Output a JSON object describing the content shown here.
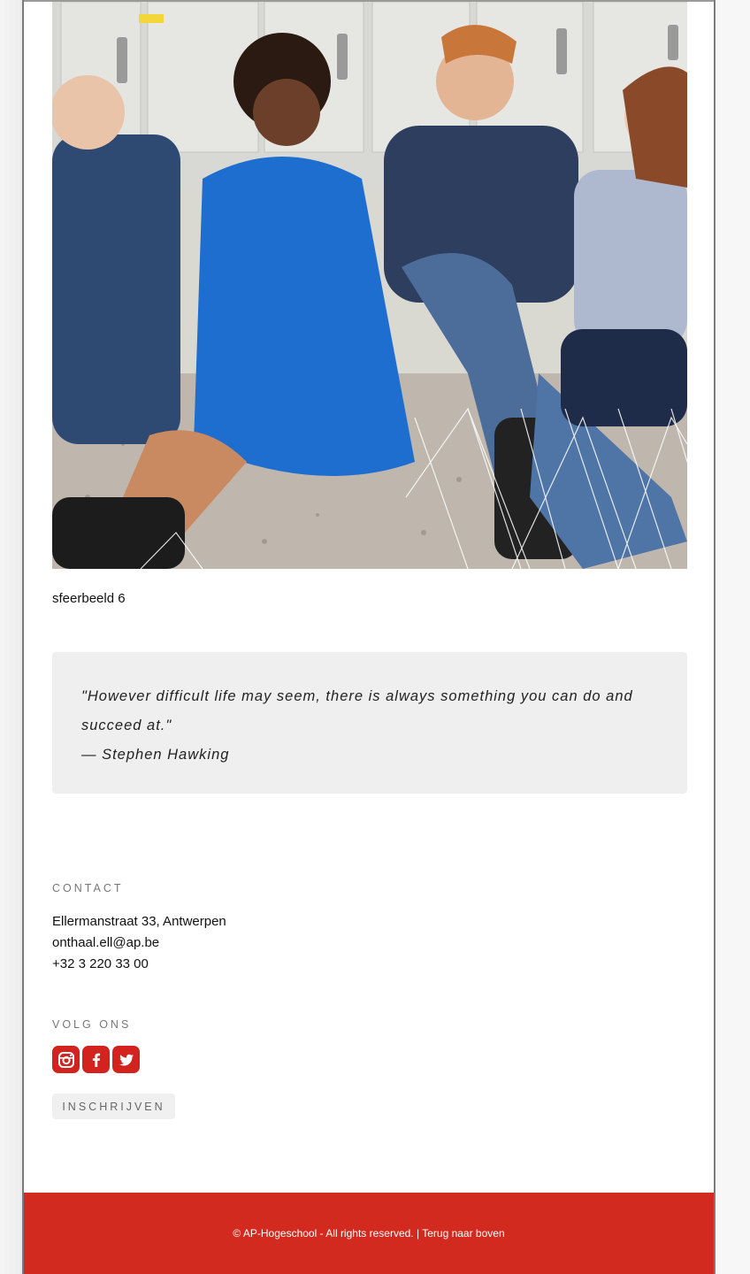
{
  "photo": {
    "caption": "sfeerbeeld 6"
  },
  "quote": {
    "text": "\"However difficult life may seem, there is always something you can do and succeed at.\"",
    "author": "— Stephen Hawking"
  },
  "contact": {
    "label": "CONTACT",
    "address": "Ellermanstraat 33, Antwerpen",
    "email": "onthaal.ell@ap.be",
    "phone": "+32 3 220 33 00"
  },
  "follow": {
    "label": "VOLG ONS",
    "icons": [
      "instagram-icon",
      "facebook-icon",
      "twitter-icon"
    ],
    "icon_color": "#d2231e"
  },
  "subscribe": {
    "label": "INSCHRIJVEN"
  },
  "footer": {
    "copyright": "© AP-Hogeschool - All rights reserved.",
    "separator": " | ",
    "back_to_top": "Terug naar boven",
    "color": "#d32a20"
  }
}
